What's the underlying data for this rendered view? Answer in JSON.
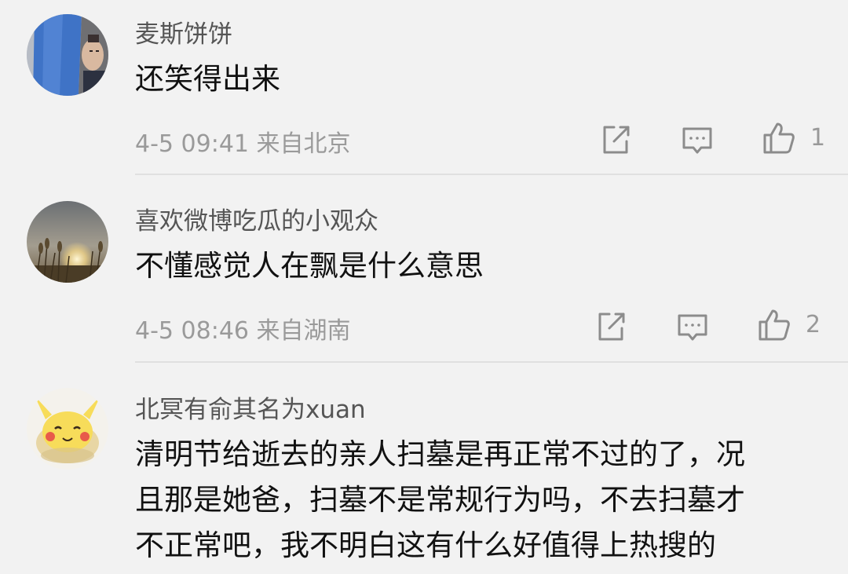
{
  "comments": [
    {
      "username": "麦斯饼饼",
      "text_lines": [
        "还笑得出来"
      ],
      "meta": "4-5 09:41 来自北京",
      "likes": "1",
      "avatar": "person-with-blue-cloth-icon"
    },
    {
      "username": "喜欢微博吃瓜的小观众",
      "text_lines": [
        "不懂感觉人在飘是什么意思"
      ],
      "meta": "4-5 08:46 来自湖南",
      "likes": "2",
      "avatar": "sunset-reeds-icon"
    },
    {
      "username": "北冥有俞其名为xuan",
      "text_lines": [
        "清明节给逝去的亲人扫墓是再正常不过的了，况",
        "且那是她爸，扫墓不是常规行为吗，不去扫墓才",
        "不正常吧，我不明白这有什么好值得上热搜的"
      ],
      "avatar": "pikachu-icon"
    }
  ],
  "colors": {
    "background": "#f2f2f2",
    "username": "#555555",
    "meta": "#9a9a9a",
    "icon": "#8c8c8c"
  }
}
